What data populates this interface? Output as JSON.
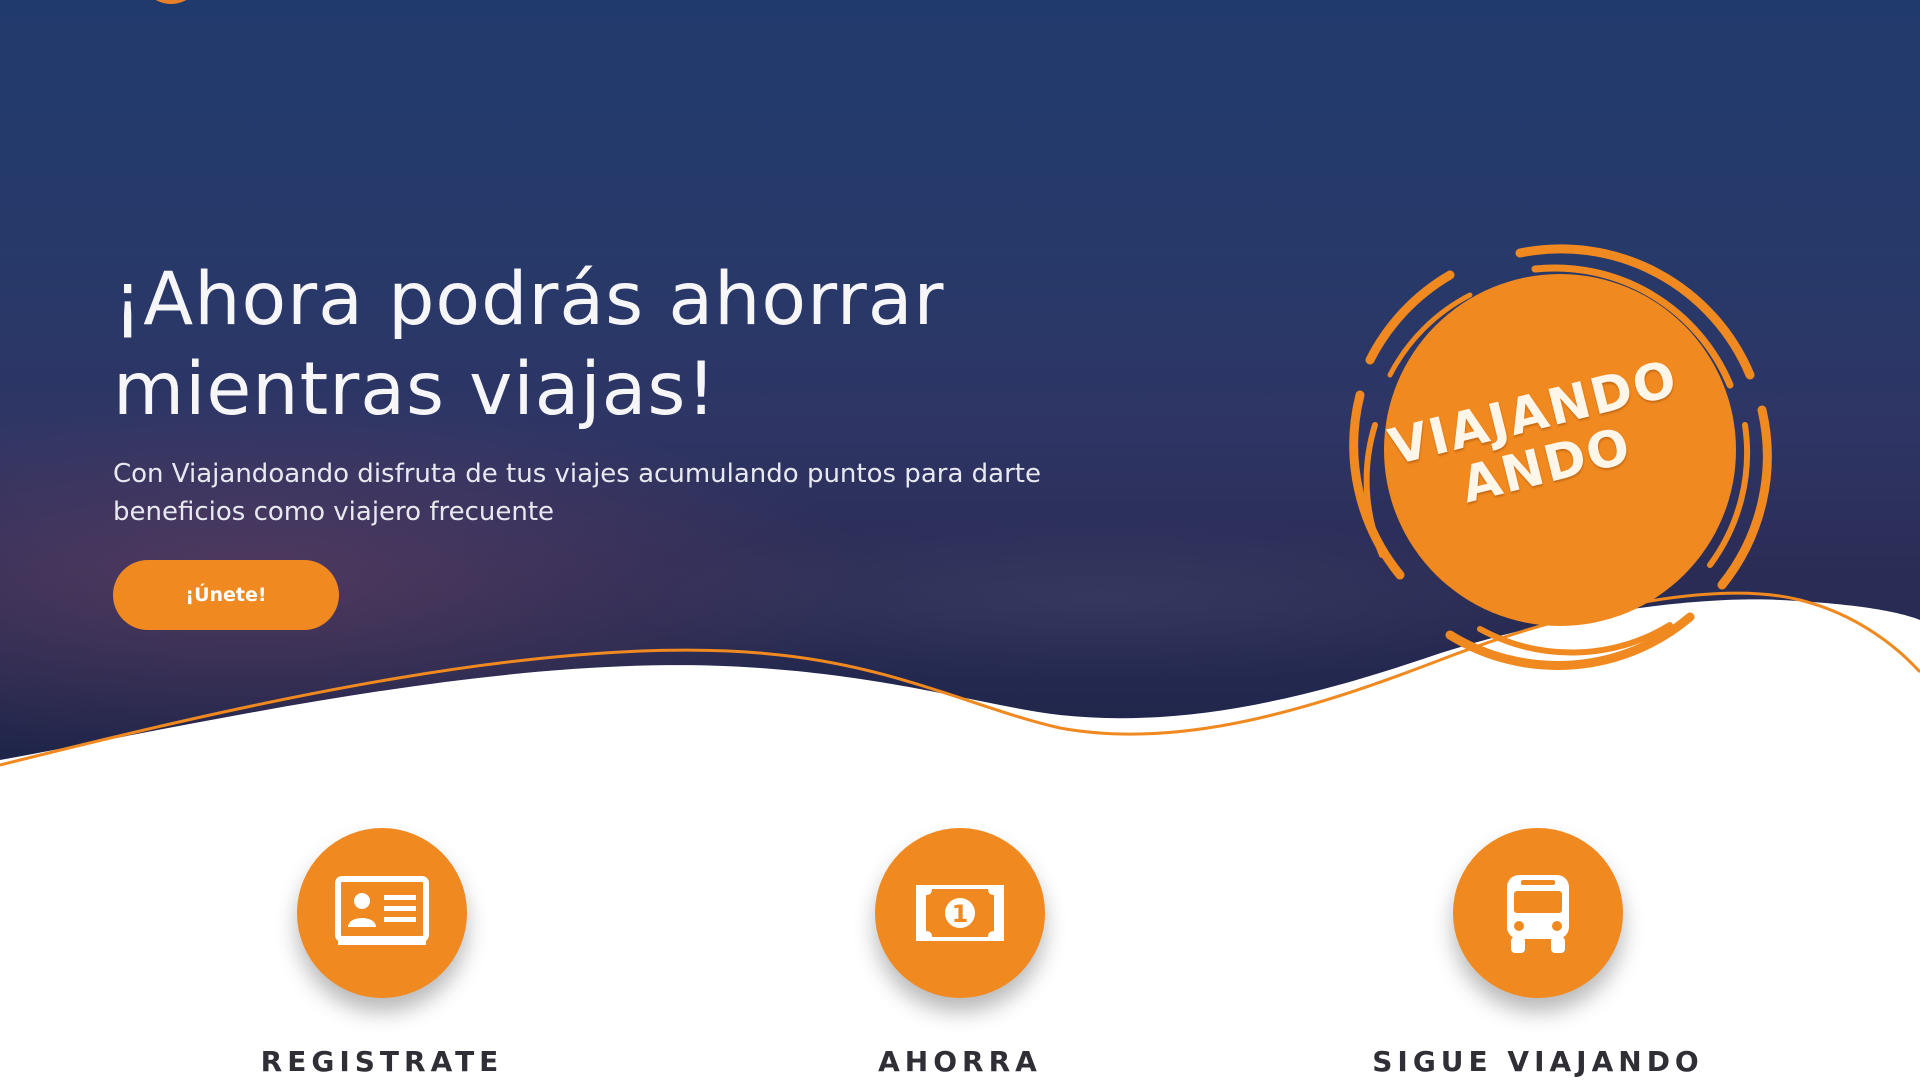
{
  "colors": {
    "accent": "#f0891f",
    "hero_dark": "#263a6a",
    "text_light": "#f6f6f8",
    "label_dark": "#2f2f35"
  },
  "hero": {
    "title": "¡Ahora podrás ahorrar mientras viajas!",
    "subtitle": "Con Viajandoando disfruta de tus viajes acumulando puntos para darte beneficios como viajero frecuente",
    "cta_label": "¡Únete!"
  },
  "badge": {
    "line1": "VIAJANDO",
    "line2": "ANDO"
  },
  "features": [
    {
      "label": "REGISTRATE",
      "icon": "id-card-icon"
    },
    {
      "label": "AHORRA",
      "icon": "banknote-icon"
    },
    {
      "label": "SIGUE VIAJANDO",
      "icon": "bus-icon"
    }
  ]
}
